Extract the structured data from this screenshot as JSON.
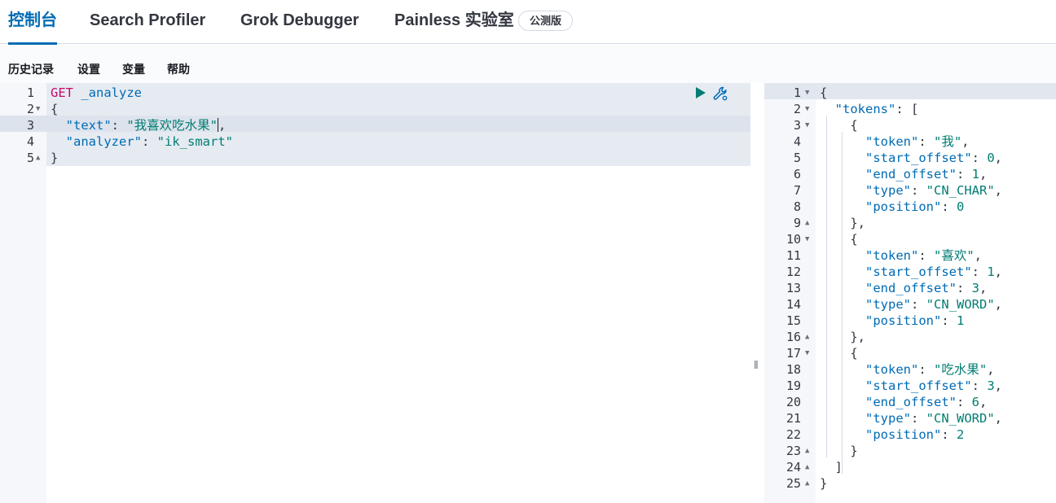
{
  "tabs": {
    "console": "控制台",
    "search_profiler": "Search Profiler",
    "grok_debugger": "Grok Debugger",
    "painless_lab": "Painless 实验室",
    "beta_badge": "公测版"
  },
  "toolbar": {
    "history": "历史记录",
    "settings": "设置",
    "variables": "变量",
    "help": "帮助"
  },
  "request": {
    "line_numbers": [
      "1",
      "2",
      "3",
      "4",
      "5"
    ],
    "method": "GET",
    "path": "_analyze",
    "open_brace": "{",
    "close_brace": "}",
    "text_key": "\"text\"",
    "text_value": "\"我喜欢吃水果\"",
    "analyzer_key": "\"analyzer\"",
    "analyzer_value": "\"ik_smart\""
  },
  "response": {
    "line_numbers": [
      "1",
      "2",
      "3",
      "4",
      "5",
      "6",
      "7",
      "8",
      "9",
      "10",
      "11",
      "12",
      "13",
      "14",
      "15",
      "16",
      "17",
      "18",
      "19",
      "20",
      "21",
      "22",
      "23",
      "24",
      "25"
    ],
    "tokens_key": "\"tokens\"",
    "keys": {
      "token": "\"token\"",
      "start_offset": "\"start_offset\"",
      "end_offset": "\"end_offset\"",
      "type": "\"type\"",
      "position": "\"position\""
    },
    "tokens": [
      {
        "token": "\"我\"",
        "start_offset": "0",
        "end_offset": "1",
        "type": "\"CN_CHAR\"",
        "position": "0"
      },
      {
        "token": "\"喜欢\"",
        "start_offset": "1",
        "end_offset": "3",
        "type": "\"CN_WORD\"",
        "position": "1"
      },
      {
        "token": "\"吃水果\"",
        "start_offset": "3",
        "end_offset": "6",
        "type": "\"CN_WORD\"",
        "position": "2"
      }
    ]
  },
  "colors": {
    "accent": "#006bb4",
    "run": "#017d73"
  },
  "icons": {
    "run": "play-icon",
    "settings": "wrench-icon",
    "resize": "drag-handle-icon"
  }
}
